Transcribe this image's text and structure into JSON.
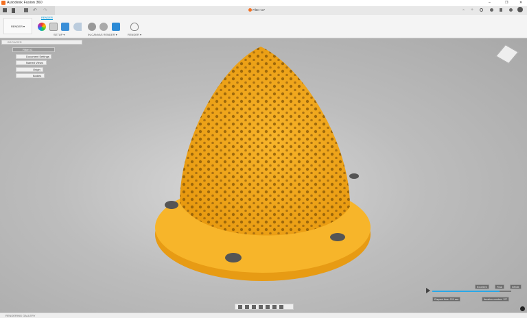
{
  "window": {
    "title": "Autodesk Fusion 360",
    "controls": [
      "–",
      "❐",
      "✕"
    ]
  },
  "document_tab": {
    "label": "Filter v1*"
  },
  "ribbon": {
    "workspace": "RENDER ▾",
    "tab": "RENDER",
    "groups": [
      "SETUP ▾",
      "IN-CANVAS RENDER ▾",
      "RENDER ▾"
    ]
  },
  "browser": {
    "title": "BROWSER",
    "root": "Filter v1",
    "items": [
      "Document Settings",
      "Named Views",
      "Origin",
      "Bodies"
    ]
  },
  "render": {
    "quality_levels": [
      "Excellent",
      "Final",
      "Infinite"
    ],
    "elapsed": "Elapsed time: 220 sec",
    "iteration": "Iteration number: 127",
    "progress": 0.85
  },
  "gallery": {
    "label": "RENDERING GALLERY"
  },
  "colors": {
    "accent": "#0696d7",
    "model": "#f5b320",
    "brand": "#f37021"
  }
}
